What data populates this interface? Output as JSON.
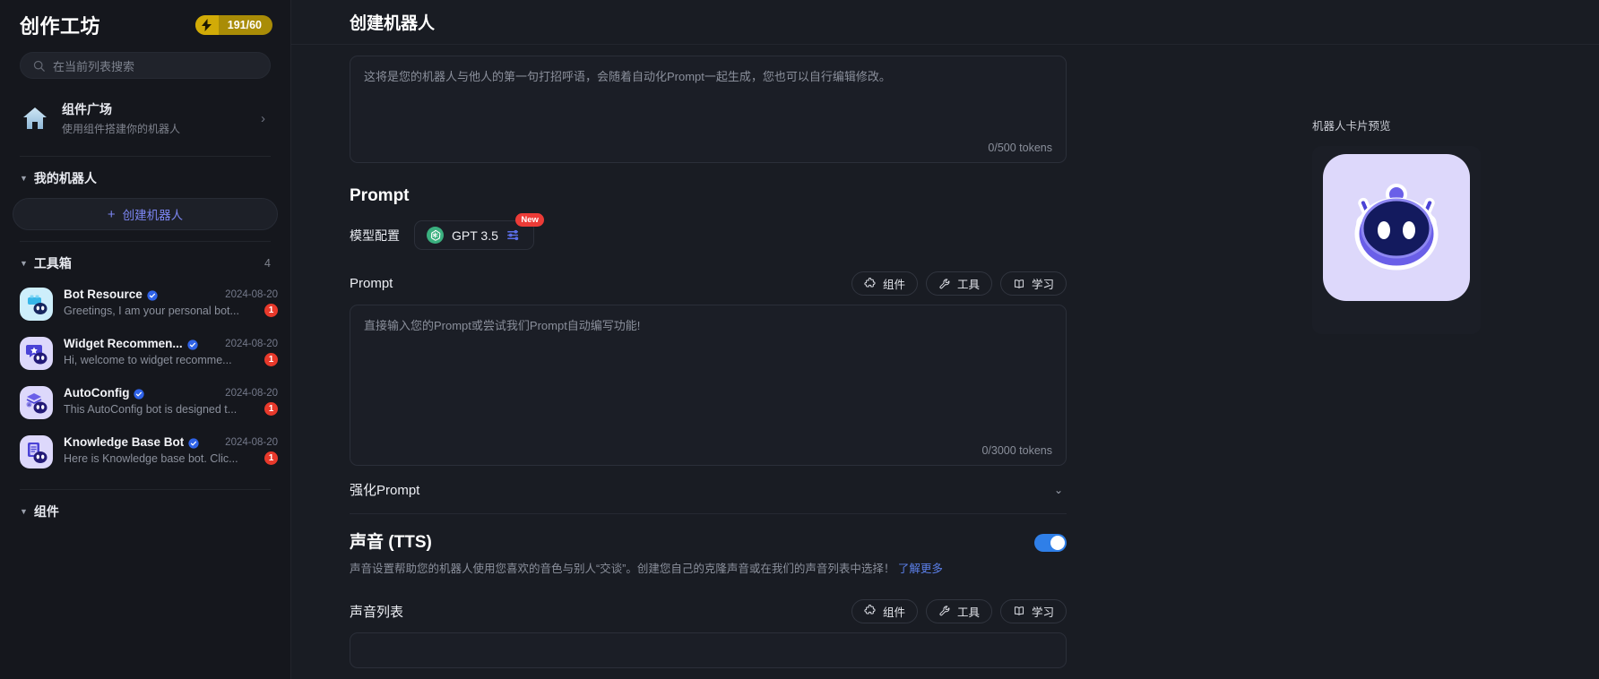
{
  "sidebar": {
    "title": "创作工坊",
    "energy": {
      "icon": "bolt-icon",
      "value": "191/60"
    },
    "search": {
      "placeholder": "在当前列表搜索",
      "icon": "search-icon"
    },
    "plaza": {
      "title": "组件广场",
      "subtitle": "使用组件搭建你的机器人",
      "icon": "home-icon",
      "chevron": "›"
    },
    "my_bots": {
      "title": "我的机器人",
      "caret": "▼"
    },
    "create_bot": {
      "plus": "+",
      "label": "创建机器人"
    },
    "toolbox": {
      "title": "工具箱",
      "caret": "▼",
      "count": "4"
    },
    "bots": [
      {
        "name": "Bot Resource",
        "date": "2024-08-20",
        "desc": "Greetings, I am your personal bot...",
        "badge": "1",
        "verified": true,
        "avatar_bg": "#cdeefb",
        "avatar_icon": "brick-bot-icon"
      },
      {
        "name": "Widget Recommen...",
        "date": "2024-08-20",
        "desc": "Hi, welcome to widget recomme...",
        "badge": "1",
        "verified": true,
        "avatar_bg": "#ddd8fb",
        "avatar_icon": "star-chat-bot-icon"
      },
      {
        "name": "AutoConfig",
        "date": "2024-08-20",
        "desc": "This AutoConfig bot is designed t...",
        "badge": "1",
        "verified": true,
        "avatar_bg": "#ddd8fb",
        "avatar_icon": "layers-bot-icon"
      },
      {
        "name": "Knowledge Base Bot",
        "date": "2024-08-20",
        "desc": "Here is Knowledge base bot. Clic...",
        "badge": "1",
        "verified": true,
        "avatar_bg": "#ddd8fb",
        "avatar_icon": "book-bot-icon"
      }
    ],
    "components": {
      "title": "组件",
      "caret": "▼"
    }
  },
  "main": {
    "page_title": "创建机器人",
    "greeting": {
      "placeholder": "这将是您的机器人与他人的第一句打招呼语，会随着自动化Prompt一起生成，您也可以自行编辑修改。",
      "counter": "0/500 tokens"
    },
    "prompt_section": {
      "heading": "Prompt",
      "model_label": "模型配置",
      "model_name": "GPT 3.5",
      "model_icon": "openai-icon",
      "sliders_icon": "sliders-icon",
      "new_badge": "New",
      "field_label": "Prompt",
      "placeholder": "直接输入您的Prompt或尝试我们Prompt自动编写功能!",
      "counter": "0/3000 tokens",
      "actions": [
        {
          "label": "组件",
          "icon": "puzzle-icon"
        },
        {
          "label": "工具",
          "icon": "wrench-icon"
        },
        {
          "label": "学习",
          "icon": "book-icon"
        }
      ]
    },
    "enhance_prompt": {
      "label": "强化Prompt",
      "chevron": "⌄"
    },
    "tts": {
      "title": "声音 (TTS)",
      "description": "声音设置帮助您的机器人使用您喜欢的音色与别人“交谈”。创建您自己的克隆声音或在我们的声音列表中选择！",
      "link": "了解更多",
      "enabled": true,
      "list_label": "声音列表",
      "actions": [
        {
          "label": "组件",
          "icon": "puzzle-icon"
        },
        {
          "label": "工具",
          "icon": "wrench-icon"
        },
        {
          "label": "学习",
          "icon": "book-icon"
        }
      ]
    }
  },
  "preview": {
    "label": "机器人卡片预览",
    "avatar_icon": "robot-avatar-icon",
    "avatar_bg": "#ddd8fb",
    "accent": "#4b43d6"
  }
}
